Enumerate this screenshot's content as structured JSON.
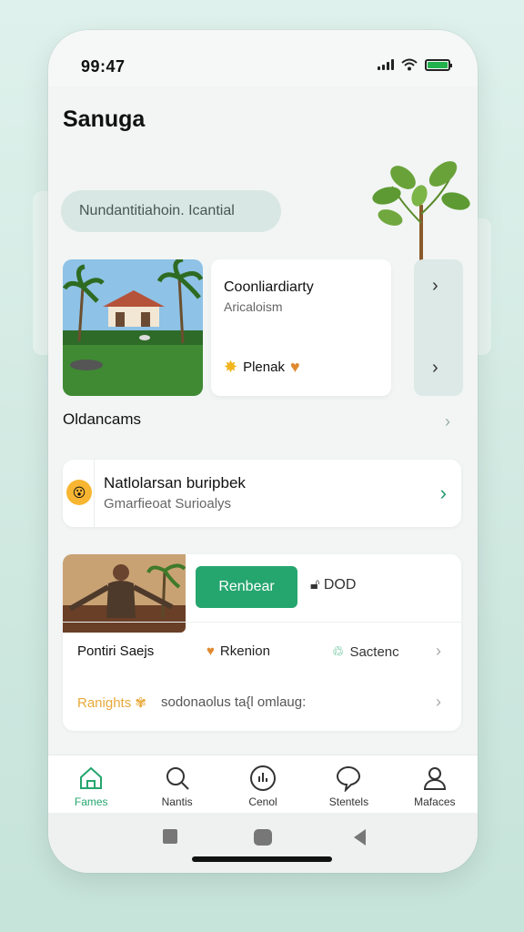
{
  "status_bar": {
    "time": "99:47"
  },
  "header": {
    "title": "Sanuga"
  },
  "search": {
    "text": "Nundantitiahoin. Icantial"
  },
  "featured": {
    "title": "Coonliardiarty",
    "subtitle": "Aricaloism",
    "tag_label": "Plenak"
  },
  "section": {
    "label": "Oldancams"
  },
  "nat_card": {
    "title": "Natlolarsan buripbek",
    "subtitle": "Gmarfieoat Surioalys"
  },
  "person_card": {
    "rent_button": "Renbear",
    "lock_value": "DOD",
    "row1": {
      "a": "Pontiri Saejs",
      "b": "Rkenion",
      "c": "Sactenc"
    },
    "row2": {
      "a": "Ranights",
      "b": "sodonaolus ta{l omlaug:"
    }
  },
  "tabs": [
    {
      "label": "Fames",
      "icon": "home-icon",
      "active": true
    },
    {
      "label": "Nantis",
      "icon": "search-icon",
      "active": false
    },
    {
      "label": "Cenol",
      "icon": "chart-icon",
      "active": false
    },
    {
      "label": "Stentels",
      "icon": "chat-icon",
      "active": false
    },
    {
      "label": "Mafaces",
      "icon": "profile-icon",
      "active": false
    }
  ],
  "colors": {
    "accent": "#26a66f",
    "background": "#cfe9e1"
  }
}
